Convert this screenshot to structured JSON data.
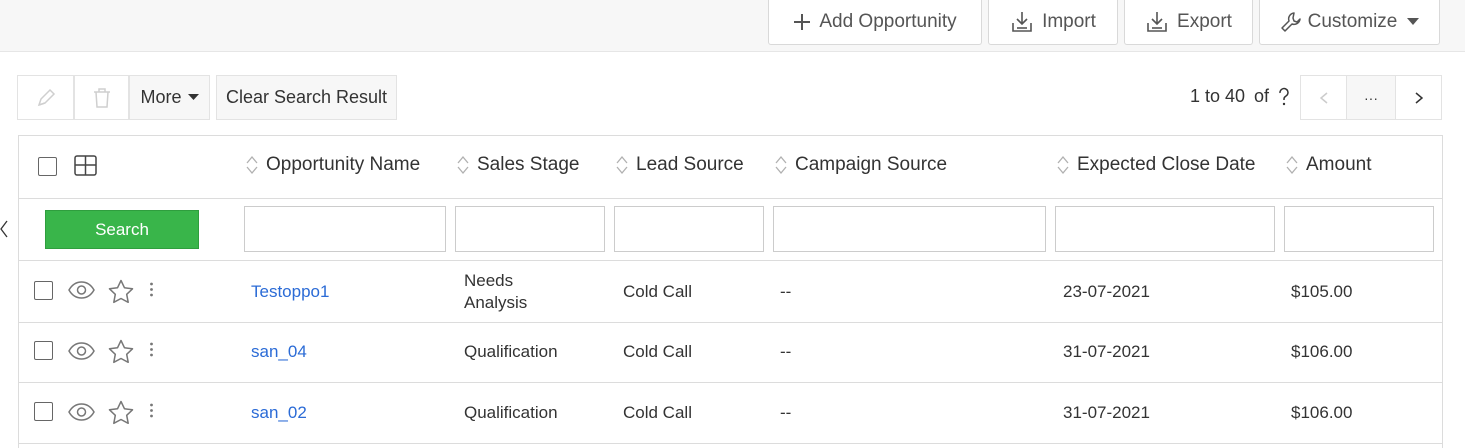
{
  "toolbar": {
    "add_label": "Add Opportunity",
    "import_label": "Import",
    "export_label": "Export",
    "customize_label": "Customize"
  },
  "actions": {
    "more_label": "More",
    "clear_label": "Clear Search Result"
  },
  "pagination": {
    "range": "1 to 40",
    "of_label": "of",
    "more_label": "···"
  },
  "columns": [
    "Opportunity Name",
    "Sales Stage",
    "Lead Source",
    "Campaign Source",
    "Expected Close Date",
    "Amount"
  ],
  "search_button": "Search",
  "rows": [
    {
      "name": "Testoppo1",
      "stage": "Needs\nAnalysis",
      "lead_source": "Cold Call",
      "campaign_source": "--",
      "close_date": "23-07-2021",
      "amount": "$105.00"
    },
    {
      "name": "san_04",
      "stage": "Qualification",
      "lead_source": "Cold Call",
      "campaign_source": "--",
      "close_date": "31-07-2021",
      "amount": "$106.00"
    },
    {
      "name": "san_02",
      "stage": "Qualification",
      "lead_source": "Cold Call",
      "campaign_source": "--",
      "close_date": "31-07-2021",
      "amount": "$106.00"
    }
  ],
  "colors": {
    "accent_green": "#39b54a",
    "link_blue": "#2b6bd6"
  },
  "icons": [
    "plus-icon",
    "import-icon",
    "export-icon",
    "wrench-icon",
    "caret-down-icon",
    "edit-icon",
    "trash-icon",
    "help-icon",
    "chevron-left-icon",
    "chevron-right-icon",
    "column-layout-icon",
    "eye-icon",
    "star-icon",
    "kebab-icon"
  ]
}
